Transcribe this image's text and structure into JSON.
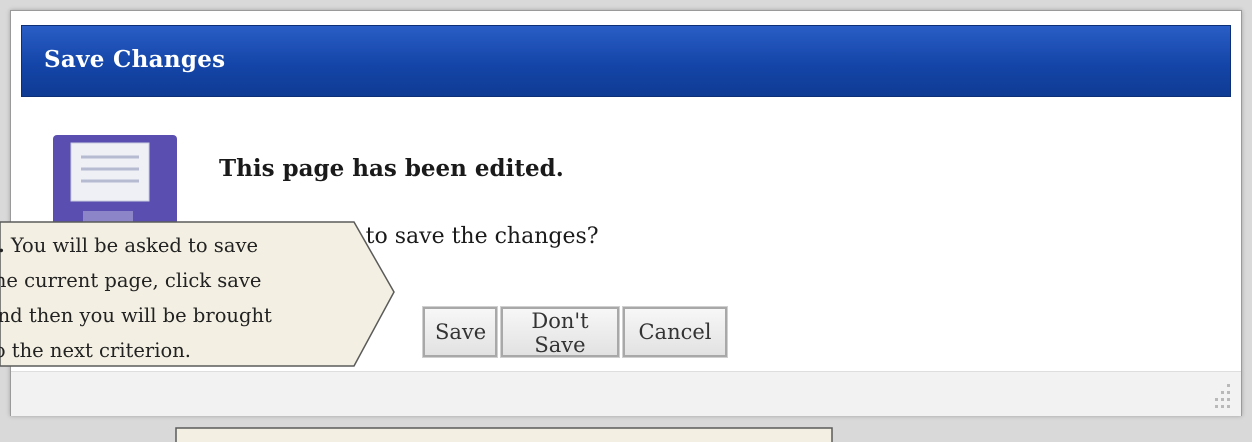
{
  "dialog": {
    "title": "Save Changes",
    "headline": "This page has been edited.",
    "question": "Do you want to save the changes?",
    "buttons": {
      "save": "Save",
      "dont_save": "Don't Save",
      "cancel": "Cancel"
    },
    "icon": "floppy-disk-icon",
    "title_color": "#1445a8"
  },
  "callout": {
    "marker": "F.",
    "lines": [
      " You will be asked to save",
      "the current page, click save",
      "and then you will be brought",
      "to the next criterion."
    ]
  }
}
